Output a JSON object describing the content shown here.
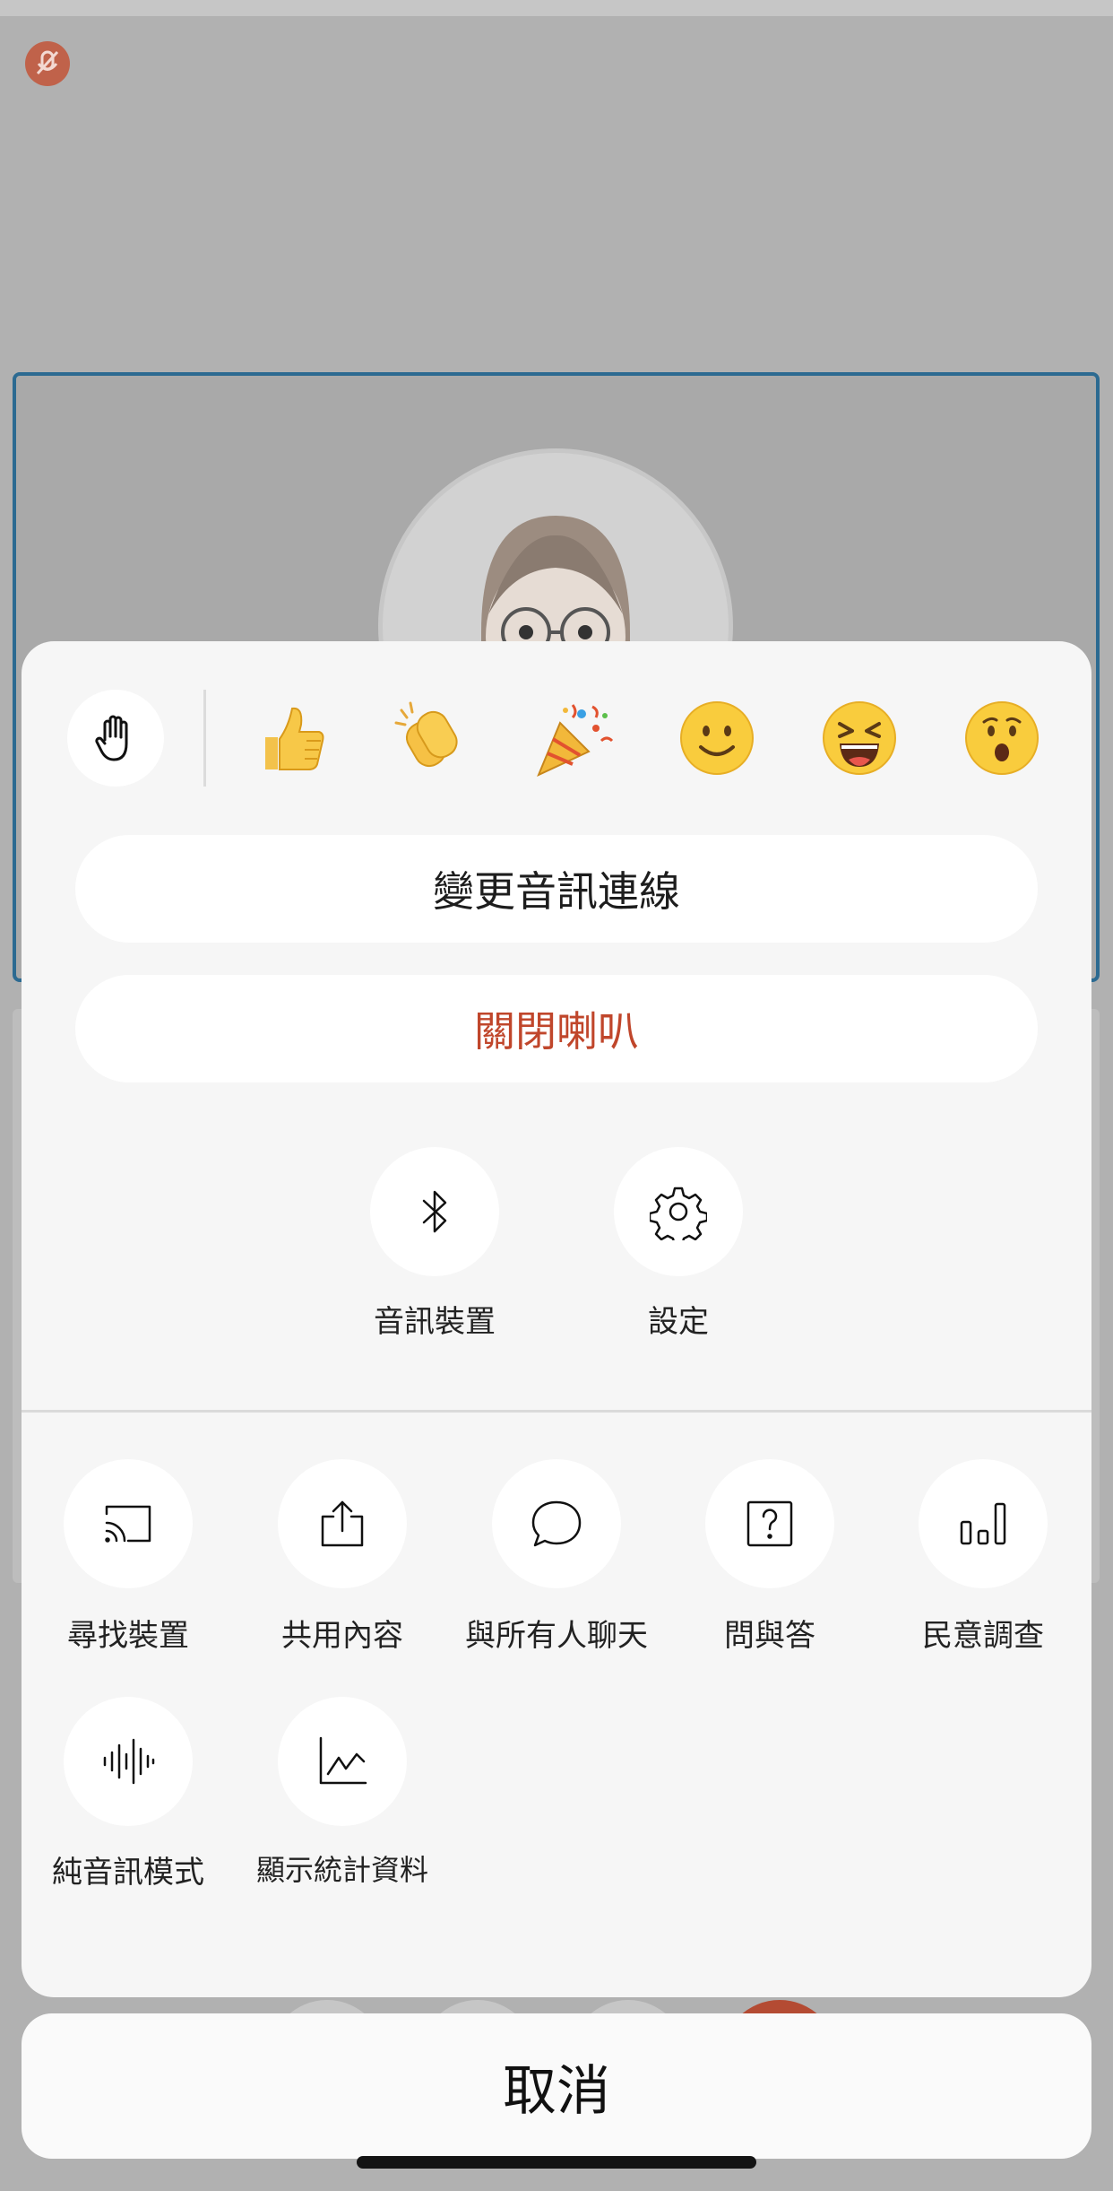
{
  "reactions": {
    "raise_hand": "raise-hand-icon",
    "emojis": [
      "👍",
      "👏",
      "🎉",
      "🙂",
      "😆",
      "😯"
    ]
  },
  "actions": {
    "change_audio": "變更音訊連線",
    "mute_speaker": "關閉喇叭"
  },
  "audio_controls": {
    "audio_device": "音訊裝置",
    "settings": "設定"
  },
  "menu": {
    "items": [
      {
        "label": "尋找裝置",
        "icon": "cast-icon"
      },
      {
        "label": "共用內容",
        "icon": "share-icon"
      },
      {
        "label": "與所有人聊天",
        "icon": "chat-icon"
      },
      {
        "label": "問與答",
        "icon": "question-icon"
      },
      {
        "label": "民意調查",
        "icon": "poll-icon"
      },
      {
        "label": "純音訊模式",
        "icon": "audio-wave-icon"
      },
      {
        "label": "顯示統計資料",
        "icon": "stats-chart-icon"
      }
    ]
  },
  "cancel_label": "取消",
  "colors": {
    "danger": "#c0462b",
    "tile_border": "#2c6a91"
  }
}
